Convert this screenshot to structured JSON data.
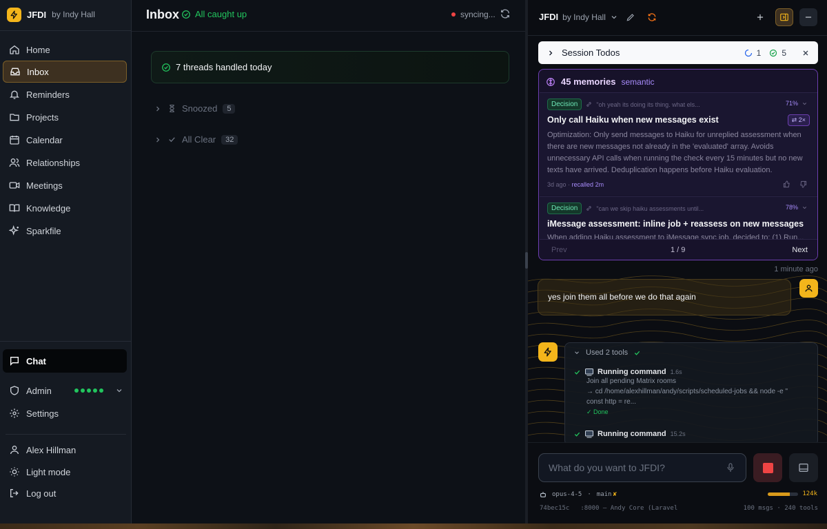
{
  "sidebar": {
    "brand": {
      "name": "JFDI",
      "by": "by Indy Hall"
    },
    "nav": [
      {
        "label": "Home",
        "icon": "home-icon"
      },
      {
        "label": "Inbox",
        "icon": "inbox-icon",
        "active": true
      },
      {
        "label": "Reminders",
        "icon": "bell-icon"
      },
      {
        "label": "Projects",
        "icon": "kanban-icon"
      },
      {
        "label": "Calendar",
        "icon": "calendar-icon"
      },
      {
        "label": "Relationships",
        "icon": "users-icon"
      },
      {
        "label": "Meetings",
        "icon": "video-icon"
      },
      {
        "label": "Knowledge",
        "icon": "book-icon"
      },
      {
        "label": "Sparkfile",
        "icon": "sparkles-icon"
      }
    ],
    "chat": {
      "label": "Chat"
    },
    "admin": {
      "label": "Admin"
    },
    "settings": {
      "label": "Settings"
    },
    "user": {
      "label": "Alex Hillman"
    },
    "light_mode": {
      "label": "Light mode"
    },
    "logout": {
      "label": "Log out"
    }
  },
  "inbox": {
    "title": "Inbox",
    "status": "All caught up",
    "sync": "syncing...",
    "handled": "7 threads handled today",
    "groups": [
      {
        "label": "Snoozed",
        "count": "5"
      },
      {
        "label": "All Clear",
        "count": "32"
      }
    ]
  },
  "panel": {
    "brand": {
      "name": "JFDI",
      "by": "by Indy Hall"
    },
    "todos": {
      "label": "Session Todos",
      "in_progress": "1",
      "done": "5"
    },
    "memories": {
      "title": "45 memories",
      "mode": "semantic",
      "cards": [
        {
          "tag": "Decision",
          "quote": "\"oh yeah its doing its thing. what els...",
          "pct": "71%",
          "title": "Only call Haiku when new messages exist",
          "badge": "2×",
          "body": "Optimization: Only send messages to Haiku for unreplied assessment when there are new messages not already in the 'evaluated' array. Avoids unnecessary API calls when running the check every 15 minutes but no new texts have arrived. Deduplication happens before Haiku evaluation.",
          "age": "3d ago ·",
          "recalled": "recalled 2m"
        },
        {
          "tag": "Decision",
          "quote": "\"can we skip haiku assessments until...",
          "pct": "78%",
          "title": "iMessage assessment: inline job + reassess on new messages",
          "body": "When adding Haiku assessment to iMessage sync job, decided to: (1) Run..."
        }
      ],
      "prev": "Prev",
      "page": "1 / 9",
      "next": "Next"
    },
    "timestamp": "1 minute ago",
    "user_message": "yes join them all before we do that again",
    "tools": {
      "header": "Used 2 tools",
      "steps": [
        {
          "name": "Running command",
          "duration": "1.6s",
          "desc1": "Join all pending Matrix rooms",
          "desc2": "→ cd /home/alexhillman/andy/scripts/scheduled-jobs && node -e \"",
          "desc3": "const http = re...",
          "status": "✓ Done"
        },
        {
          "name": "Running command",
          "duration": "15.2s"
        }
      ]
    },
    "input": {
      "placeholder": "What do you want to JFDI?"
    },
    "status": {
      "model": "opus-4-5",
      "sep": "·",
      "branch": "main",
      "branch_mark": "✘",
      "commit": "74bec15c",
      "server": ":8000 — Andy Core (Laravel",
      "context": "124k",
      "context_fill": 0.72,
      "stats": "100 msgs · 240 tools"
    }
  },
  "colors": {
    "accent": "#f3b51b",
    "success": "#22c55e",
    "danger": "#ef4444",
    "memory_purple": "#6d3fb0"
  }
}
